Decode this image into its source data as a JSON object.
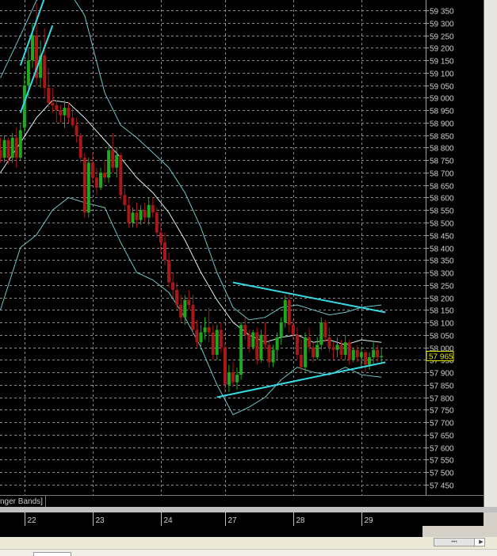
{
  "indicator": {
    "label": "nger Bands]"
  },
  "chart_data": {
    "type": "candlestick",
    "y_range": [
      57408,
      59392
    ],
    "price_axis": {
      "tick_labels": [
        "59 350",
        "59 300",
        "59 250",
        "59 200",
        "59 150",
        "59 100",
        "59 050",
        "59 000",
        "58 950",
        "58 900",
        "58 850",
        "58 800",
        "58 750",
        "58 700",
        "58 650",
        "58 600",
        "58 550",
        "58 500",
        "58 450",
        "58 400",
        "58 350",
        "58 300",
        "58 250",
        "58 200",
        "58 150",
        "58 100",
        "58 050",
        "58 000",
        "57 950",
        "57 900",
        "57 850",
        "57 800",
        "57 750",
        "57 700",
        "57 650",
        "57 600",
        "57 550",
        "57 500",
        "57 450"
      ],
      "current_price_label": "57 965",
      "current_price": 57965
    },
    "time_axis": {
      "labels": [
        "22",
        "23",
        "24",
        "27",
        "28",
        "29"
      ],
      "label_bar_index": [
        6,
        23,
        40,
        56,
        73,
        90
      ]
    },
    "bar_count": 96,
    "candles": [
      {
        "o": 58790,
        "h": 58840,
        "l": 58740,
        "c": 58760
      },
      {
        "o": 58760,
        "h": 58850,
        "l": 58740,
        "c": 58830
      },
      {
        "o": 58830,
        "h": 58840,
        "l": 58730,
        "c": 58760
      },
      {
        "o": 58760,
        "h": 58860,
        "l": 58740,
        "c": 58840
      },
      {
        "o": 58840,
        "h": 58880,
        "l": 58720,
        "c": 58760
      },
      {
        "o": 58760,
        "h": 58900,
        "l": 58750,
        "c": 58870
      },
      {
        "o": 58880,
        "h": 59100,
        "l": 58860,
        "c": 59050
      },
      {
        "o": 59050,
        "h": 59200,
        "l": 59000,
        "c": 59150
      },
      {
        "o": 59150,
        "h": 59300,
        "l": 59120,
        "c": 59250
      },
      {
        "o": 59250,
        "h": 59380,
        "l": 59050,
        "c": 59080
      },
      {
        "o": 59080,
        "h": 59230,
        "l": 59040,
        "c": 59170
      },
      {
        "o": 59170,
        "h": 59280,
        "l": 59000,
        "c": 59040
      },
      {
        "o": 59040,
        "h": 59120,
        "l": 58960,
        "c": 58980
      },
      {
        "o": 58980,
        "h": 59040,
        "l": 58940,
        "c": 58970
      },
      {
        "o": 58970,
        "h": 58990,
        "l": 58900,
        "c": 58950
      },
      {
        "o": 58950,
        "h": 58970,
        "l": 58900,
        "c": 58930
      },
      {
        "o": 58930,
        "h": 58990,
        "l": 58880,
        "c": 58960
      },
      {
        "o": 58960,
        "h": 58980,
        "l": 58900,
        "c": 58920
      },
      {
        "o": 58920,
        "h": 58960,
        "l": 58880,
        "c": 58890
      },
      {
        "o": 58890,
        "h": 58920,
        "l": 58820,
        "c": 58850
      },
      {
        "o": 58850,
        "h": 58860,
        "l": 58740,
        "c": 58760
      },
      {
        "o": 58760,
        "h": 58780,
        "l": 58520,
        "c": 58540
      },
      {
        "o": 58540,
        "h": 58760,
        "l": 58520,
        "c": 58740
      },
      {
        "o": 58740,
        "h": 58780,
        "l": 58660,
        "c": 58680
      },
      {
        "o": 58680,
        "h": 58720,
        "l": 58610,
        "c": 58640
      },
      {
        "o": 58640,
        "h": 58720,
        "l": 58630,
        "c": 58700
      },
      {
        "o": 58700,
        "h": 58750,
        "l": 58660,
        "c": 58680
      },
      {
        "o": 58680,
        "h": 58810,
        "l": 58660,
        "c": 58790
      },
      {
        "o": 58790,
        "h": 58860,
        "l": 58700,
        "c": 58720
      },
      {
        "o": 58720,
        "h": 58800,
        "l": 58680,
        "c": 58770
      },
      {
        "o": 58770,
        "h": 58780,
        "l": 58590,
        "c": 58610
      },
      {
        "o": 58610,
        "h": 58640,
        "l": 58550,
        "c": 58570
      },
      {
        "o": 58570,
        "h": 58600,
        "l": 58480,
        "c": 58500
      },
      {
        "o": 58500,
        "h": 58560,
        "l": 58480,
        "c": 58540
      },
      {
        "o": 58540,
        "h": 58580,
        "l": 58480,
        "c": 58510
      },
      {
        "o": 58510,
        "h": 58570,
        "l": 58490,
        "c": 58550
      },
      {
        "o": 58550,
        "h": 58580,
        "l": 58500,
        "c": 58520
      },
      {
        "o": 58520,
        "h": 58600,
        "l": 58490,
        "c": 58570
      },
      {
        "o": 58570,
        "h": 58600,
        "l": 58520,
        "c": 58540
      },
      {
        "o": 58540,
        "h": 58560,
        "l": 58440,
        "c": 58460
      },
      {
        "o": 58460,
        "h": 58500,
        "l": 58380,
        "c": 58420
      },
      {
        "o": 58420,
        "h": 58460,
        "l": 58330,
        "c": 58350
      },
      {
        "o": 58350,
        "h": 58380,
        "l": 58240,
        "c": 58260
      },
      {
        "o": 58260,
        "h": 58300,
        "l": 58200,
        "c": 58230
      },
      {
        "o": 58230,
        "h": 58260,
        "l": 58150,
        "c": 58170
      },
      {
        "o": 58170,
        "h": 58210,
        "l": 58100,
        "c": 58120
      },
      {
        "o": 58120,
        "h": 58210,
        "l": 58090,
        "c": 58190
      },
      {
        "o": 58190,
        "h": 58230,
        "l": 58150,
        "c": 58170
      },
      {
        "o": 58170,
        "h": 58210,
        "l": 58050,
        "c": 58070
      },
      {
        "o": 58070,
        "h": 58110,
        "l": 58000,
        "c": 58020
      },
      {
        "o": 58020,
        "h": 58090,
        "l": 57990,
        "c": 58060
      },
      {
        "o": 58060,
        "h": 58120,
        "l": 58030,
        "c": 58080
      },
      {
        "o": 58080,
        "h": 58160,
        "l": 58020,
        "c": 58060
      },
      {
        "o": 58060,
        "h": 58090,
        "l": 57950,
        "c": 57970
      },
      {
        "o": 57970,
        "h": 58090,
        "l": 57950,
        "c": 58070
      },
      {
        "o": 58070,
        "h": 58100,
        "l": 57980,
        "c": 58000
      },
      {
        "o": 58000,
        "h": 58020,
        "l": 57820,
        "c": 57850
      },
      {
        "o": 57850,
        "h": 57930,
        "l": 57820,
        "c": 57900
      },
      {
        "o": 57900,
        "h": 57940,
        "l": 57840,
        "c": 57860
      },
      {
        "o": 57860,
        "h": 57920,
        "l": 57830,
        "c": 57890
      },
      {
        "o": 57890,
        "h": 58100,
        "l": 57870,
        "c": 58090
      },
      {
        "o": 58090,
        "h": 58120,
        "l": 58030,
        "c": 58050
      },
      {
        "o": 58050,
        "h": 58070,
        "l": 57980,
        "c": 58000
      },
      {
        "o": 58000,
        "h": 58070,
        "l": 57990,
        "c": 58060
      },
      {
        "o": 58060,
        "h": 58080,
        "l": 57930,
        "c": 57950
      },
      {
        "o": 57950,
        "h": 58070,
        "l": 57940,
        "c": 58050
      },
      {
        "o": 58050,
        "h": 58100,
        "l": 57990,
        "c": 58010
      },
      {
        "o": 58010,
        "h": 58030,
        "l": 57920,
        "c": 57940
      },
      {
        "o": 57940,
        "h": 58010,
        "l": 57920,
        "c": 57990
      },
      {
        "o": 57990,
        "h": 58060,
        "l": 57950,
        "c": 58040
      },
      {
        "o": 58040,
        "h": 58120,
        "l": 58010,
        "c": 58100
      },
      {
        "o": 58100,
        "h": 58210,
        "l": 58080,
        "c": 58190
      },
      {
        "o": 58190,
        "h": 58220,
        "l": 58060,
        "c": 58090
      },
      {
        "o": 58090,
        "h": 58110,
        "l": 58030,
        "c": 58050
      },
      {
        "o": 58050,
        "h": 58080,
        "l": 57950,
        "c": 57970
      },
      {
        "o": 57970,
        "h": 58030,
        "l": 57900,
        "c": 57920
      },
      {
        "o": 57920,
        "h": 58060,
        "l": 57900,
        "c": 58040
      },
      {
        "o": 58040,
        "h": 58080,
        "l": 57980,
        "c": 58000
      },
      {
        "o": 58000,
        "h": 58020,
        "l": 57940,
        "c": 57960
      },
      {
        "o": 57960,
        "h": 58040,
        "l": 57950,
        "c": 58010
      },
      {
        "o": 58010,
        "h": 58120,
        "l": 57990,
        "c": 58100
      },
      {
        "o": 58100,
        "h": 58110,
        "l": 58020,
        "c": 58040
      },
      {
        "o": 58040,
        "h": 58080,
        "l": 57980,
        "c": 58000
      },
      {
        "o": 58000,
        "h": 58020,
        "l": 57950,
        "c": 57990
      },
      {
        "o": 57990,
        "h": 58040,
        "l": 57960,
        "c": 58010
      },
      {
        "o": 58010,
        "h": 58030,
        "l": 57950,
        "c": 57970
      },
      {
        "o": 57970,
        "h": 58050,
        "l": 57950,
        "c": 58020
      },
      {
        "o": 58020,
        "h": 58030,
        "l": 57930,
        "c": 57950
      },
      {
        "o": 57950,
        "h": 58000,
        "l": 57940,
        "c": 57990
      },
      {
        "o": 57990,
        "h": 58010,
        "l": 57940,
        "c": 57960
      },
      {
        "o": 57960,
        "h": 58000,
        "l": 57920,
        "c": 57980
      },
      {
        "o": 57980,
        "h": 57990,
        "l": 57900,
        "c": 57930
      },
      {
        "o": 57930,
        "h": 57980,
        "l": 57910,
        "c": 57960
      },
      {
        "o": 57960,
        "h": 58020,
        "l": 57930,
        "c": 57990
      },
      {
        "o": 57990,
        "h": 58010,
        "l": 57940,
        "c": 57960
      },
      {
        "o": 57960,
        "h": 58000,
        "l": 57940,
        "c": 57965
      }
    ],
    "bollinger": {
      "upper": [
        {
          "i": 0,
          "v": 59080
        },
        {
          "i": 5,
          "v": 59250
        },
        {
          "i": 9,
          "v": 59390
        },
        {
          "i": 13,
          "v": 59430
        },
        {
          "i": 17,
          "v": 59430
        },
        {
          "i": 21,
          "v": 59330
        },
        {
          "i": 26,
          "v": 59020
        },
        {
          "i": 30,
          "v": 58890
        },
        {
          "i": 34,
          "v": 58840
        },
        {
          "i": 38,
          "v": 58780
        },
        {
          "i": 42,
          "v": 58720
        },
        {
          "i": 46,
          "v": 58620
        },
        {
          "i": 50,
          "v": 58480
        },
        {
          "i": 54,
          "v": 58300
        },
        {
          "i": 58,
          "v": 58160
        },
        {
          "i": 62,
          "v": 58110
        },
        {
          "i": 66,
          "v": 58120
        },
        {
          "i": 70,
          "v": 58160
        },
        {
          "i": 74,
          "v": 58170
        },
        {
          "i": 78,
          "v": 58150
        },
        {
          "i": 82,
          "v": 58130
        },
        {
          "i": 86,
          "v": 58140
        },
        {
          "i": 90,
          "v": 58160
        },
        {
          "i": 95,
          "v": 58170
        }
      ],
      "middle": [
        {
          "i": 0,
          "v": 58700
        },
        {
          "i": 5,
          "v": 58820
        },
        {
          "i": 9,
          "v": 58920
        },
        {
          "i": 13,
          "v": 58990
        },
        {
          "i": 17,
          "v": 58980
        },
        {
          "i": 21,
          "v": 58920
        },
        {
          "i": 26,
          "v": 58830
        },
        {
          "i": 30,
          "v": 58760
        },
        {
          "i": 34,
          "v": 58680
        },
        {
          "i": 38,
          "v": 58620
        },
        {
          "i": 42,
          "v": 58540
        },
        {
          "i": 46,
          "v": 58430
        },
        {
          "i": 50,
          "v": 58300
        },
        {
          "i": 54,
          "v": 58190
        },
        {
          "i": 58,
          "v": 58100
        },
        {
          "i": 62,
          "v": 58050
        },
        {
          "i": 66,
          "v": 58020
        },
        {
          "i": 70,
          "v": 58040
        },
        {
          "i": 74,
          "v": 58050
        },
        {
          "i": 78,
          "v": 58020
        },
        {
          "i": 82,
          "v": 58030
        },
        {
          "i": 86,
          "v": 58010
        },
        {
          "i": 90,
          "v": 58030
        },
        {
          "i": 95,
          "v": 58020
        }
      ],
      "lower": [
        {
          "i": 0,
          "v": 58150
        },
        {
          "i": 5,
          "v": 58400
        },
        {
          "i": 9,
          "v": 58450
        },
        {
          "i": 13,
          "v": 58550
        },
        {
          "i": 17,
          "v": 58600
        },
        {
          "i": 21,
          "v": 58580
        },
        {
          "i": 26,
          "v": 58560
        },
        {
          "i": 30,
          "v": 58420
        },
        {
          "i": 34,
          "v": 58300
        },
        {
          "i": 38,
          "v": 58270
        },
        {
          "i": 42,
          "v": 58220
        },
        {
          "i": 46,
          "v": 58120
        },
        {
          "i": 50,
          "v": 58000
        },
        {
          "i": 54,
          "v": 57850
        },
        {
          "i": 58,
          "v": 57730
        },
        {
          "i": 62,
          "v": 57760
        },
        {
          "i": 66,
          "v": 57800
        },
        {
          "i": 70,
          "v": 57870
        },
        {
          "i": 74,
          "v": 57920
        },
        {
          "i": 78,
          "v": 57900
        },
        {
          "i": 82,
          "v": 57890
        },
        {
          "i": 86,
          "v": 57920
        },
        {
          "i": 90,
          "v": 57890
        },
        {
          "i": 95,
          "v": 57880
        }
      ]
    },
    "trendlines": [
      {
        "name": "steep-up-1",
        "x1": 5,
        "y1": 59130,
        "x2": 11,
        "y2": 59400
      },
      {
        "name": "steep-up-2",
        "x1": 5,
        "y1": 58940,
        "x2": 13,
        "y2": 59290
      },
      {
        "name": "triangle-upper",
        "x1": 58,
        "y1": 58260,
        "x2": 96,
        "y2": 58140
      },
      {
        "name": "triangle-lower",
        "x1": 54,
        "y1": 57800,
        "x2": 96,
        "y2": 57940
      }
    ],
    "colors": {
      "background": "#000000",
      "grid": "#8c8c8c",
      "bull": "#1ea81e",
      "bear": "#a81818",
      "bands": "#6fc7c8",
      "trendline": "#39d9e3",
      "scale_text": "#cfcfcf",
      "price_marker": "#e7e800"
    },
    "grid": true
  }
}
